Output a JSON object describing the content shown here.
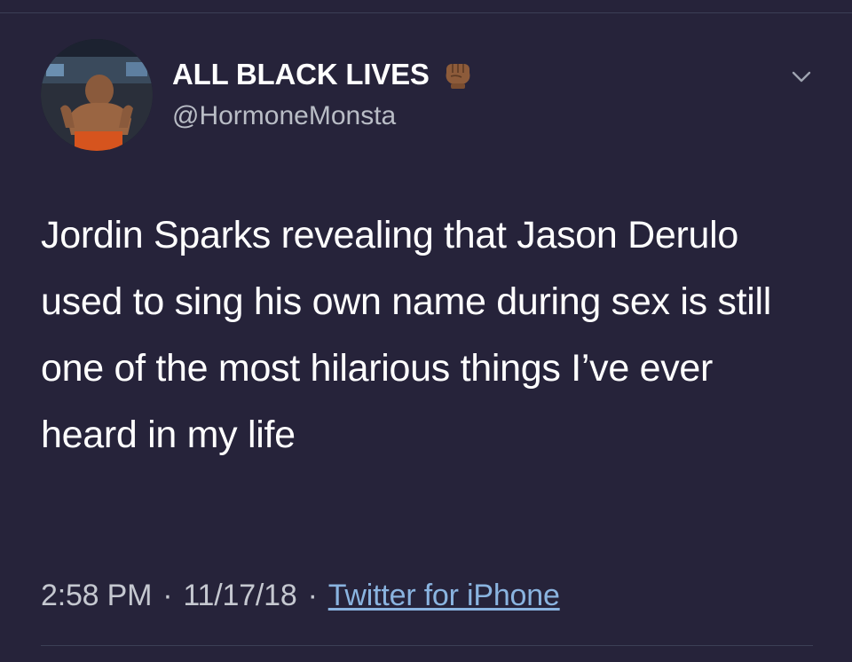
{
  "tweet": {
    "author": {
      "display_name": "ALL BLACK LIVES",
      "name_emoji_icon": "raised-fist-icon",
      "handle": "@HormoneMonsta"
    },
    "menu_icon": "chevron-down-icon",
    "text": "Jordin Sparks revealing that Jason Derulo used to sing his own name during sex is still one of the most hilarious things I’ve ever heard in my life",
    "time": "2:58 PM",
    "date": "11/17/18",
    "separator": "·",
    "source": "Twitter for iPhone"
  },
  "colors": {
    "background": "#26233a",
    "text": "#ffffff",
    "secondary_text": "#b9bdc6",
    "link": "#8ab4e0",
    "divider": "#3c3f55"
  }
}
